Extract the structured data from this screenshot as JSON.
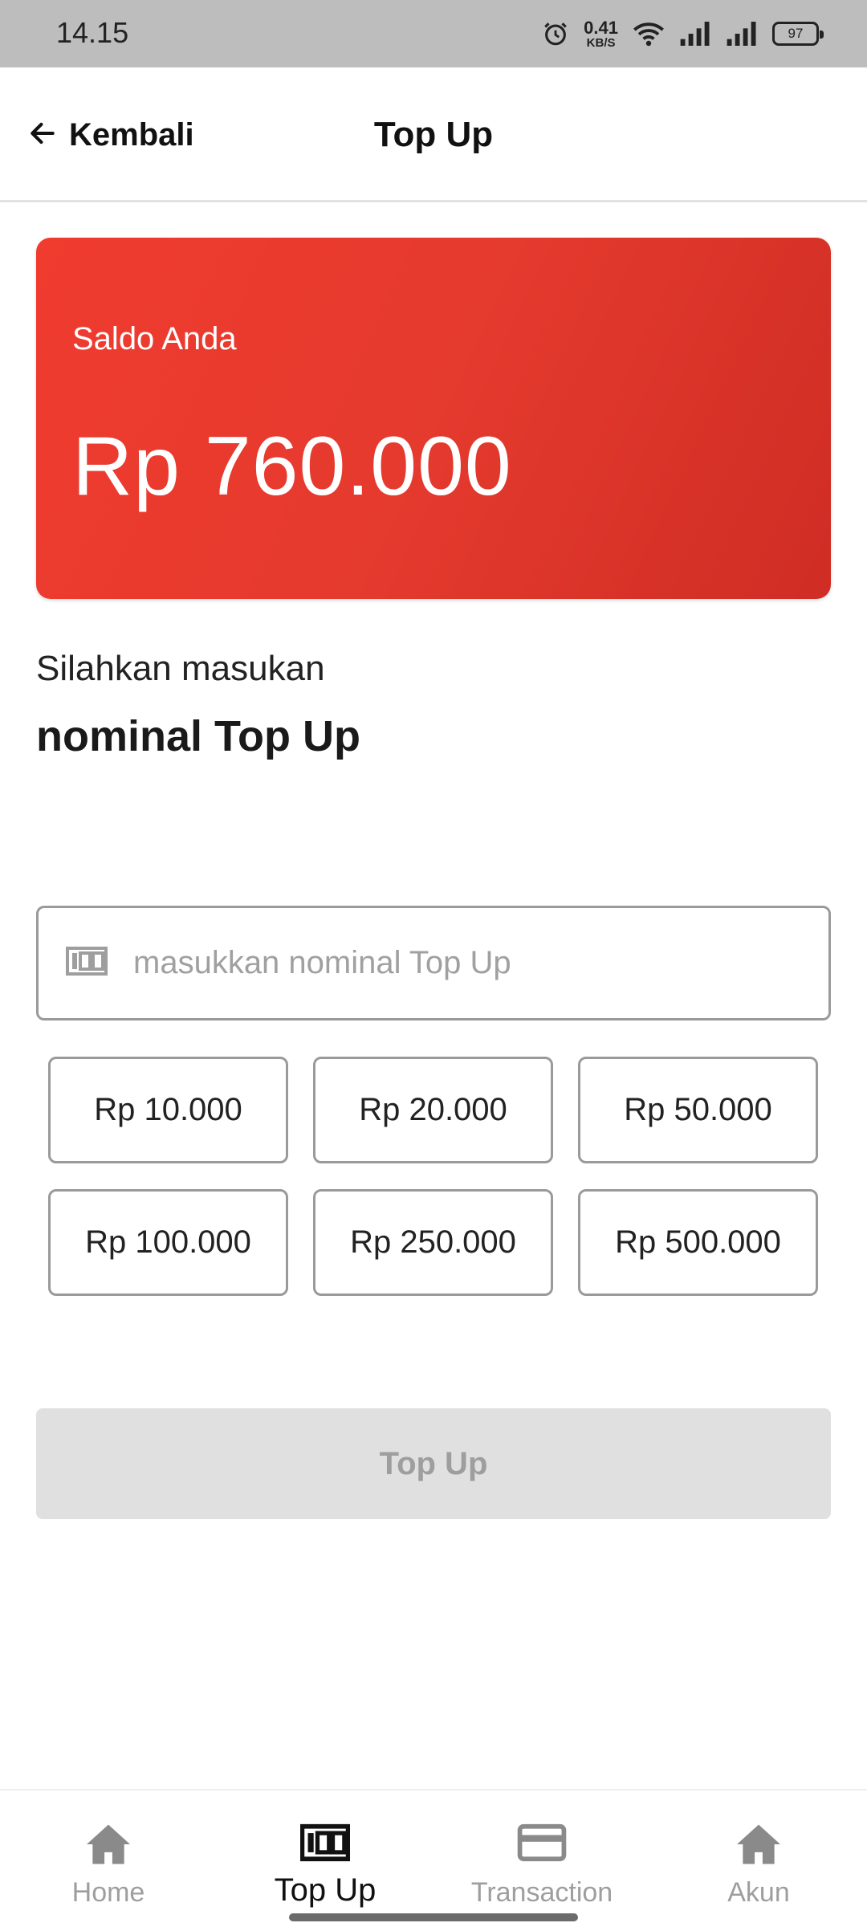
{
  "status_bar": {
    "time": "14.15",
    "net_speed_value": "0.41",
    "net_speed_unit": "KB/S",
    "battery": "97",
    "icons": [
      "alarm-icon",
      "wifi-icon",
      "signal-icon",
      "signal-icon",
      "battery-icon"
    ]
  },
  "header": {
    "back_label": "Kembali",
    "title": "Top Up",
    "back_icon": "arrow-left-icon"
  },
  "balance": {
    "label": "Saldo Anda",
    "amount": "Rp 760.000",
    "accent": "#e53a2e"
  },
  "prompt": {
    "line1": "Silahkan masukan",
    "line2": "nominal Top Up"
  },
  "amount_input": {
    "value": "",
    "placeholder": "masukkan nominal Top Up",
    "icon": "money-icon"
  },
  "presets": [
    {
      "label": "Rp 10.000"
    },
    {
      "label": "Rp 20.000"
    },
    {
      "label": "Rp 50.000"
    },
    {
      "label": "Rp 100.000"
    },
    {
      "label": "Rp 250.000"
    },
    {
      "label": "Rp 500.000"
    }
  ],
  "submit": {
    "label": "Top Up",
    "enabled": false
  },
  "bottom_nav": {
    "items": [
      {
        "label": "Home",
        "icon": "home-icon",
        "active": false
      },
      {
        "label": "Top Up",
        "icon": "money-icon",
        "active": true
      },
      {
        "label": "Transaction",
        "icon": "credit-card-icon",
        "active": false
      },
      {
        "label": "Akun",
        "icon": "home-icon",
        "active": false
      }
    ]
  }
}
